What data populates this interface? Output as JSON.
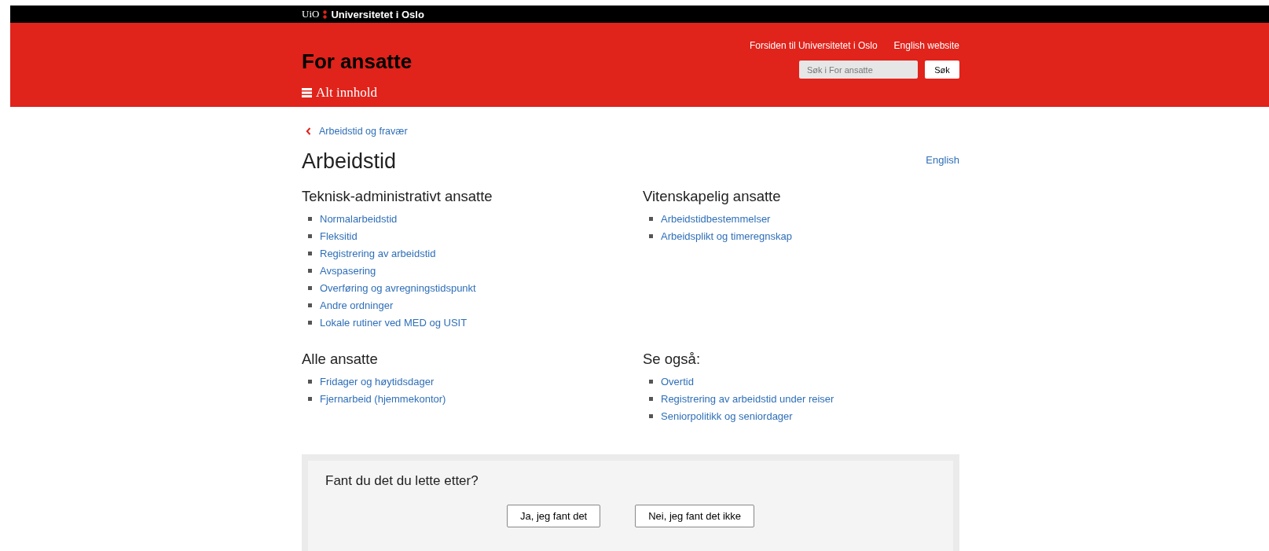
{
  "topbar": {
    "logo_short": "UiO",
    "logo_name": "Universitetet i Oslo"
  },
  "header": {
    "title": "For ansatte",
    "menu_label": "Alt innhold",
    "links": [
      "Forsiden til Universitetet i Oslo",
      "English website"
    ],
    "search": {
      "placeholder": "Søk i For ansatte",
      "button": "Søk"
    }
  },
  "breadcrumb": "Arbeidstid og fravær",
  "page_title": "Arbeidstid",
  "language_link": "English",
  "sections": [
    {
      "heading": "Teknisk-administrativt ansatte",
      "links": [
        "Normalarbeidstid",
        "Fleksitid",
        "Registrering av arbeidstid",
        "Avspasering",
        "Overføring og avregningstidspunkt",
        "Andre ordninger",
        "Lokale rutiner ved MED og USIT"
      ]
    },
    {
      "heading": "Vitenskapelig ansatte",
      "links": [
        "Arbeidstidbestemmelser",
        "Arbeidsplikt og timeregnskap"
      ]
    },
    {
      "heading": "Alle ansatte",
      "links": [
        "Fridager og høytidsdager",
        "Fjernarbeid (hjemmekontor)"
      ]
    },
    {
      "heading": "Se også:",
      "links": [
        "Overtid",
        "Registrering av arbeidstid under reiser",
        "Seniorpolitikk og seniordager"
      ]
    }
  ],
  "feedback": {
    "question": "Fant du det du lette etter?",
    "buttons": [
      "Ja, jeg fant det",
      "Nei, jeg fant det ikke"
    ]
  }
}
